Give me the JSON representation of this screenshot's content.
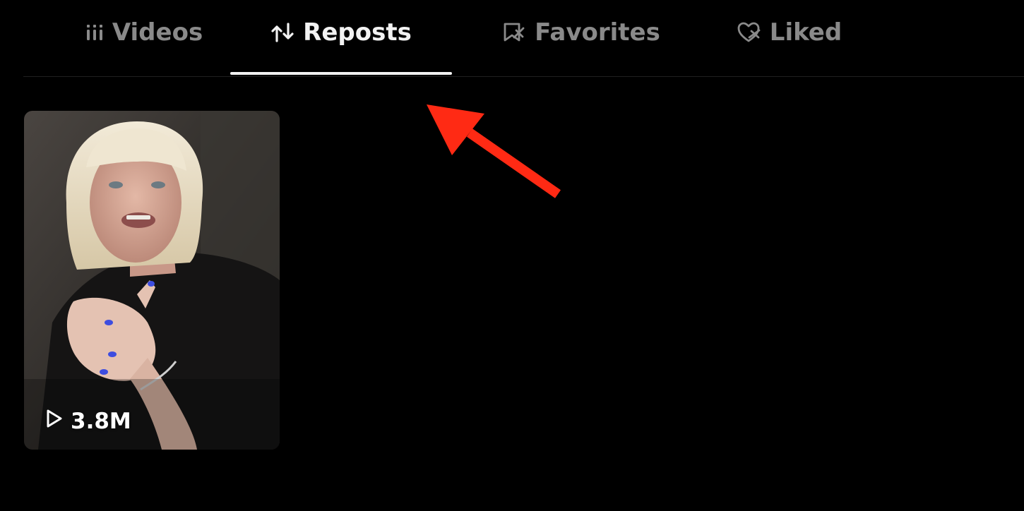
{
  "tabs": [
    {
      "label": "Videos",
      "icon": "grid-dots-icon",
      "active": false
    },
    {
      "label": "Reposts",
      "icon": "repost-icon",
      "active": true
    },
    {
      "label": "Favorites",
      "icon": "bookmark-icon",
      "active": false
    },
    {
      "label": "Liked",
      "icon": "heart-icon",
      "active": false
    }
  ],
  "videos": [
    {
      "views": "3.8M",
      "icon": "play-icon"
    }
  ],
  "colors": {
    "background": "#000000",
    "tab_active": "#f2f2f2",
    "tab_inactive": "#8a8a8a",
    "annotation_arrow": "#ff2a14"
  }
}
